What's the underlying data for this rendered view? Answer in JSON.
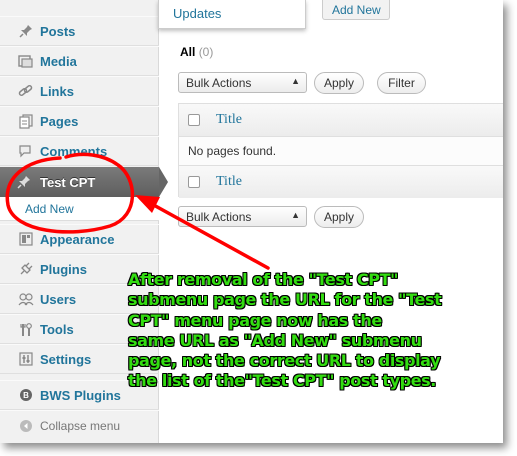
{
  "topbar": {
    "updates_label": "Updates",
    "add_new_label": "Add New"
  },
  "sidebar": {
    "items": [
      {
        "label": "Posts",
        "icon": "pushpin-icon"
      },
      {
        "label": "Media",
        "icon": "media-icon"
      },
      {
        "label": "Links",
        "icon": "link-icon"
      },
      {
        "label": "Pages",
        "icon": "pages-icon"
      },
      {
        "label": "Comments",
        "icon": "comments-icon"
      },
      {
        "label": "Test CPT",
        "icon": "pushpin-icon"
      },
      {
        "label": "Appearance",
        "icon": "appearance-icon"
      },
      {
        "label": "Plugins",
        "icon": "plugins-icon"
      },
      {
        "label": "Users",
        "icon": "users-icon"
      },
      {
        "label": "Tools",
        "icon": "tools-icon"
      },
      {
        "label": "Settings",
        "icon": "settings-icon"
      },
      {
        "label": "BWS Plugins",
        "icon": "bws-icon"
      },
      {
        "label": "Collapse menu",
        "icon": "collapse-icon"
      }
    ],
    "submenu": {
      "label": "Add New"
    }
  },
  "list": {
    "filter_all": "All",
    "filter_count": "(0)",
    "bulk_actions": "Bulk Actions",
    "apply": "Apply",
    "filter": "Filter",
    "col_title": "Title",
    "empty_text": "No pages found."
  },
  "annotation": {
    "lines": [
      "After removal of the \"Test CPT\"",
      "submenu page the URL for the \"Test",
      "CPT\" menu page now has the",
      "same URL as \"Add New\" submenu",
      "page, not the correct URL to display",
      "the list of the\"Test CPT\" post types."
    ]
  },
  "colors": {
    "link": "#21759b",
    "annotation_text": "#33dd11",
    "annotation_stroke": "#ff0000"
  }
}
